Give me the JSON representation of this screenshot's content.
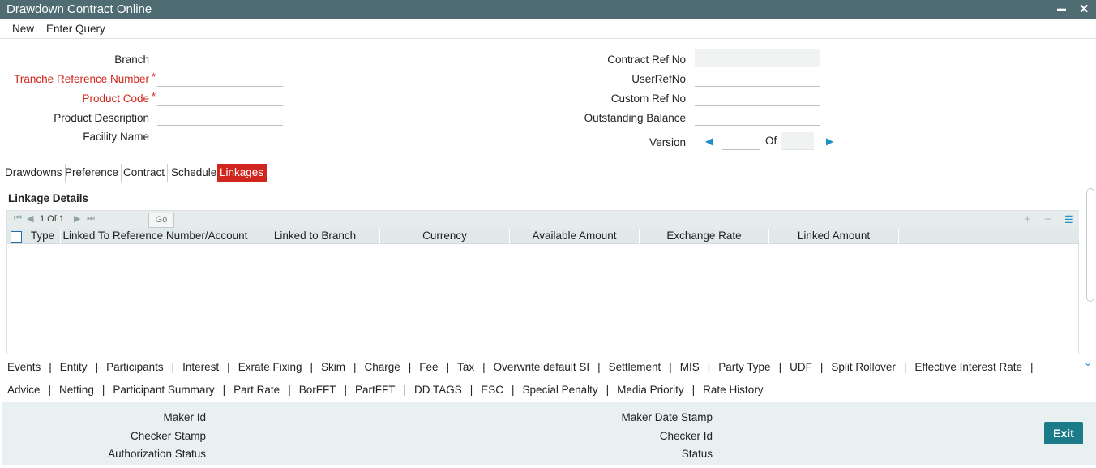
{
  "window": {
    "title": "Drawdown Contract Online",
    "minimize": "▬",
    "close": "✕"
  },
  "menu": {
    "new": "New",
    "enter_query": "Enter Query"
  },
  "form": {
    "branch_label": "Branch",
    "tranche_label": "Tranche Reference Number",
    "product_code_label": "Product Code",
    "product_desc_label": "Product Description",
    "facility_label": "Facility Name",
    "contract_ref_label": "Contract Ref No",
    "user_ref_label": "UserRefNo",
    "custom_ref_label": "Custom Ref No",
    "outstanding_label": "Outstanding Balance",
    "version_label": "Version",
    "of_label": "Of",
    "required_mark": "*"
  },
  "tabs": [
    "Drawdowns",
    "Preference",
    "Contract",
    "Schedule",
    "Linkages"
  ],
  "active_tab": "Linkages",
  "linkage": {
    "title": "Linkage Details",
    "pager": "1 Of 1",
    "go": "Go",
    "columns": [
      "Type",
      "Linked To Reference Number/Account",
      "Linked to Branch",
      "Currency",
      "Available Amount",
      "Exchange Rate",
      "Linked Amount"
    ]
  },
  "links_row1": [
    "Events",
    "Entity",
    "Participants",
    "Interest",
    "Exrate Fixing",
    "Skim",
    "Charge",
    "Fee",
    "Tax",
    "Overwrite default SI",
    "Settlement",
    "MIS",
    "Party Type",
    "UDF",
    "Split Rollover",
    "Effective Interest Rate"
  ],
  "links_row2": [
    "Advice",
    "Netting",
    "Participant Summary",
    "Part Rate",
    "BorFFT",
    "PartFFT",
    "DD TAGS",
    "ESC",
    "Special Penalty",
    "Media Priority",
    "Rate History"
  ],
  "footer": {
    "maker_id": "Maker Id",
    "checker_stamp": "Checker Stamp",
    "auth_status": "Authorization Status",
    "maker_date": "Maker Date Stamp",
    "checker_id": "Checker Id",
    "status": "Status",
    "exit": "Exit"
  },
  "colors": {
    "titlebar": "#4e6c71",
    "active_tab": "#d0261d",
    "exit": "#1c7b89",
    "footer": "#e8f0f1"
  }
}
